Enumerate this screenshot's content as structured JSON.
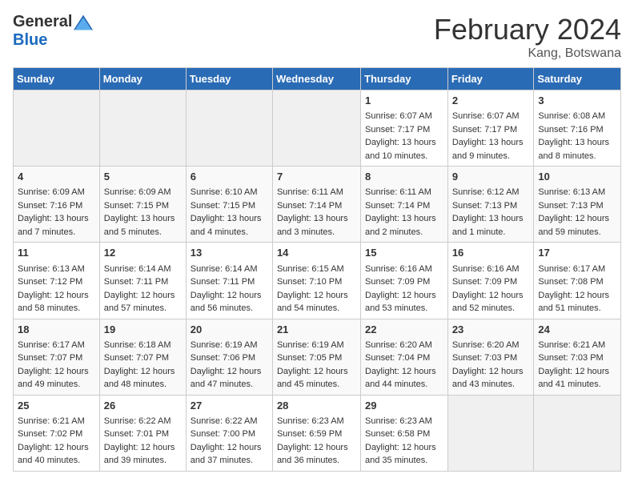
{
  "header": {
    "logo_general": "General",
    "logo_blue": "Blue",
    "month_title": "February 2024",
    "location": "Kang, Botswana"
  },
  "weekdays": [
    "Sunday",
    "Monday",
    "Tuesday",
    "Wednesday",
    "Thursday",
    "Friday",
    "Saturday"
  ],
  "weeks": [
    [
      {
        "num": "",
        "info": ""
      },
      {
        "num": "",
        "info": ""
      },
      {
        "num": "",
        "info": ""
      },
      {
        "num": "",
        "info": ""
      },
      {
        "num": "1",
        "info": "Sunrise: 6:07 AM\nSunset: 7:17 PM\nDaylight: 13 hours\nand 10 minutes."
      },
      {
        "num": "2",
        "info": "Sunrise: 6:07 AM\nSunset: 7:17 PM\nDaylight: 13 hours\nand 9 minutes."
      },
      {
        "num": "3",
        "info": "Sunrise: 6:08 AM\nSunset: 7:16 PM\nDaylight: 13 hours\nand 8 minutes."
      }
    ],
    [
      {
        "num": "4",
        "info": "Sunrise: 6:09 AM\nSunset: 7:16 PM\nDaylight: 13 hours\nand 7 minutes."
      },
      {
        "num": "5",
        "info": "Sunrise: 6:09 AM\nSunset: 7:15 PM\nDaylight: 13 hours\nand 5 minutes."
      },
      {
        "num": "6",
        "info": "Sunrise: 6:10 AM\nSunset: 7:15 PM\nDaylight: 13 hours\nand 4 minutes."
      },
      {
        "num": "7",
        "info": "Sunrise: 6:11 AM\nSunset: 7:14 PM\nDaylight: 13 hours\nand 3 minutes."
      },
      {
        "num": "8",
        "info": "Sunrise: 6:11 AM\nSunset: 7:14 PM\nDaylight: 13 hours\nand 2 minutes."
      },
      {
        "num": "9",
        "info": "Sunrise: 6:12 AM\nSunset: 7:13 PM\nDaylight: 13 hours\nand 1 minute."
      },
      {
        "num": "10",
        "info": "Sunrise: 6:13 AM\nSunset: 7:13 PM\nDaylight: 12 hours\nand 59 minutes."
      }
    ],
    [
      {
        "num": "11",
        "info": "Sunrise: 6:13 AM\nSunset: 7:12 PM\nDaylight: 12 hours\nand 58 minutes."
      },
      {
        "num": "12",
        "info": "Sunrise: 6:14 AM\nSunset: 7:11 PM\nDaylight: 12 hours\nand 57 minutes."
      },
      {
        "num": "13",
        "info": "Sunrise: 6:14 AM\nSunset: 7:11 PM\nDaylight: 12 hours\nand 56 minutes."
      },
      {
        "num": "14",
        "info": "Sunrise: 6:15 AM\nSunset: 7:10 PM\nDaylight: 12 hours\nand 54 minutes."
      },
      {
        "num": "15",
        "info": "Sunrise: 6:16 AM\nSunset: 7:09 PM\nDaylight: 12 hours\nand 53 minutes."
      },
      {
        "num": "16",
        "info": "Sunrise: 6:16 AM\nSunset: 7:09 PM\nDaylight: 12 hours\nand 52 minutes."
      },
      {
        "num": "17",
        "info": "Sunrise: 6:17 AM\nSunset: 7:08 PM\nDaylight: 12 hours\nand 51 minutes."
      }
    ],
    [
      {
        "num": "18",
        "info": "Sunrise: 6:17 AM\nSunset: 7:07 PM\nDaylight: 12 hours\nand 49 minutes."
      },
      {
        "num": "19",
        "info": "Sunrise: 6:18 AM\nSunset: 7:07 PM\nDaylight: 12 hours\nand 48 minutes."
      },
      {
        "num": "20",
        "info": "Sunrise: 6:19 AM\nSunset: 7:06 PM\nDaylight: 12 hours\nand 47 minutes."
      },
      {
        "num": "21",
        "info": "Sunrise: 6:19 AM\nSunset: 7:05 PM\nDaylight: 12 hours\nand 45 minutes."
      },
      {
        "num": "22",
        "info": "Sunrise: 6:20 AM\nSunset: 7:04 PM\nDaylight: 12 hours\nand 44 minutes."
      },
      {
        "num": "23",
        "info": "Sunrise: 6:20 AM\nSunset: 7:03 PM\nDaylight: 12 hours\nand 43 minutes."
      },
      {
        "num": "24",
        "info": "Sunrise: 6:21 AM\nSunset: 7:03 PM\nDaylight: 12 hours\nand 41 minutes."
      }
    ],
    [
      {
        "num": "25",
        "info": "Sunrise: 6:21 AM\nSunset: 7:02 PM\nDaylight: 12 hours\nand 40 minutes."
      },
      {
        "num": "26",
        "info": "Sunrise: 6:22 AM\nSunset: 7:01 PM\nDaylight: 12 hours\nand 39 minutes."
      },
      {
        "num": "27",
        "info": "Sunrise: 6:22 AM\nSunset: 7:00 PM\nDaylight: 12 hours\nand 37 minutes."
      },
      {
        "num": "28",
        "info": "Sunrise: 6:23 AM\nSunset: 6:59 PM\nDaylight: 12 hours\nand 36 minutes."
      },
      {
        "num": "29",
        "info": "Sunrise: 6:23 AM\nSunset: 6:58 PM\nDaylight: 12 hours\nand 35 minutes."
      },
      {
        "num": "",
        "info": ""
      },
      {
        "num": "",
        "info": ""
      }
    ]
  ]
}
